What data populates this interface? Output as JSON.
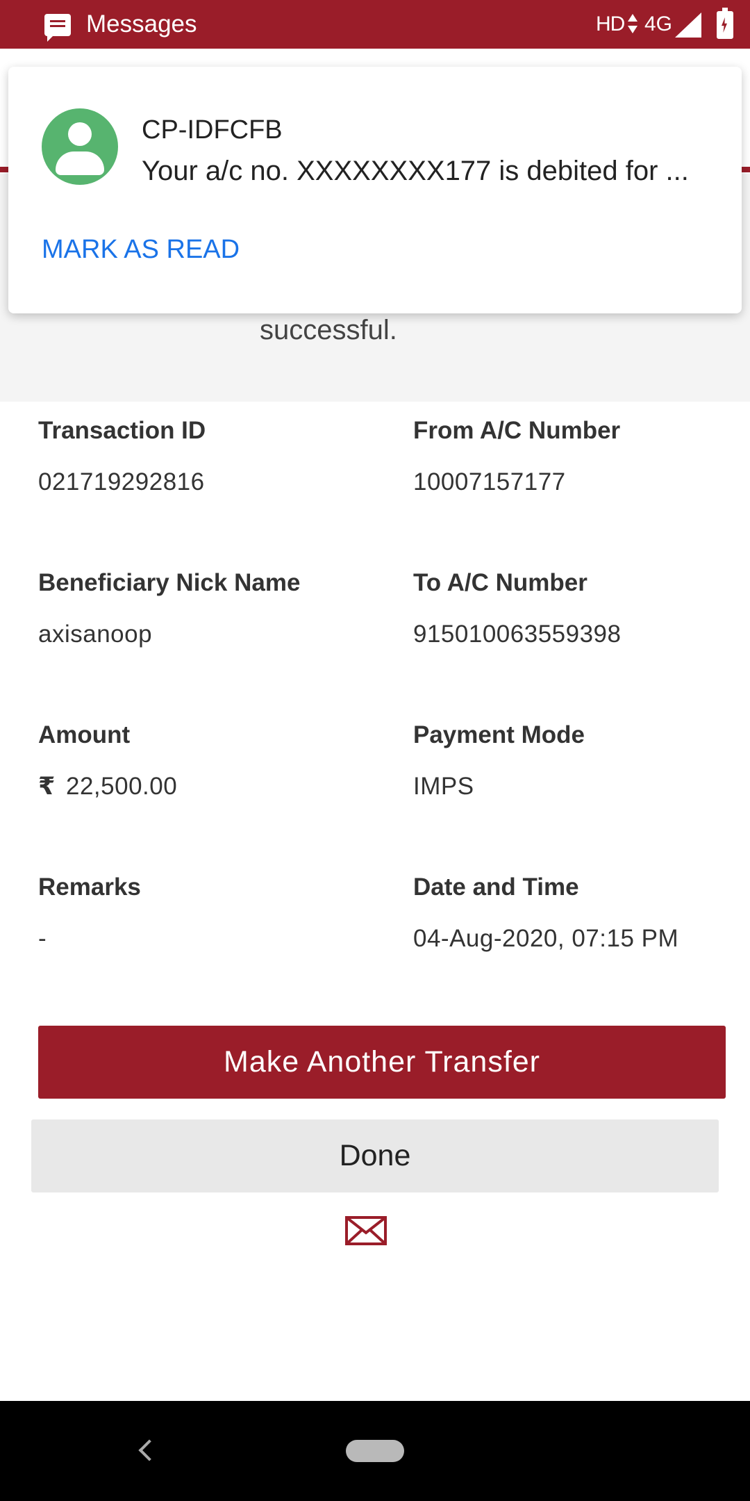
{
  "status_bar": {
    "app_name": "Messages",
    "network_hd": "HD",
    "network_type": "4G",
    "icons": [
      "messages-icon",
      "data-arrows-icon",
      "signal-icon",
      "battery-charging-icon"
    ]
  },
  "notification": {
    "sender": "CP-IDFCFB",
    "preview": "Your a/c no. XXXXXXXX177 is debited for ...",
    "action_label": "MARK AS READ",
    "avatar_icon": "person-icon",
    "avatar_color": "#57b46f",
    "action_color": "#1a73e8"
  },
  "header": {
    "success_text": "successful."
  },
  "details": {
    "transaction_id": {
      "label": "Transaction ID",
      "value": "021719292816"
    },
    "from_account": {
      "label": "From A/C Number",
      "value": "10007157177"
    },
    "beneficiary": {
      "label": "Beneficiary Nick Name",
      "value": "axisanoop"
    },
    "to_account": {
      "label": "To A/C Number",
      "value": "915010063559398"
    },
    "amount": {
      "label": "Amount",
      "currency": "₹",
      "value": "22,500.00"
    },
    "payment_mode": {
      "label": "Payment Mode",
      "value": "IMPS"
    },
    "remarks": {
      "label": "Remarks",
      "value": "-"
    },
    "date_time": {
      "label": "Date and Time",
      "value": "04-Aug-2020, 07:15 PM"
    }
  },
  "actions": {
    "primary_label": "Make Another Transfer",
    "secondary_label": "Done",
    "email_icon": "envelope-icon"
  },
  "theme": {
    "brand_color": "#9a1d29",
    "nav_bg": "#000000"
  },
  "nav_bar": {
    "icons": [
      "back-icon",
      "home-pill-icon"
    ]
  }
}
